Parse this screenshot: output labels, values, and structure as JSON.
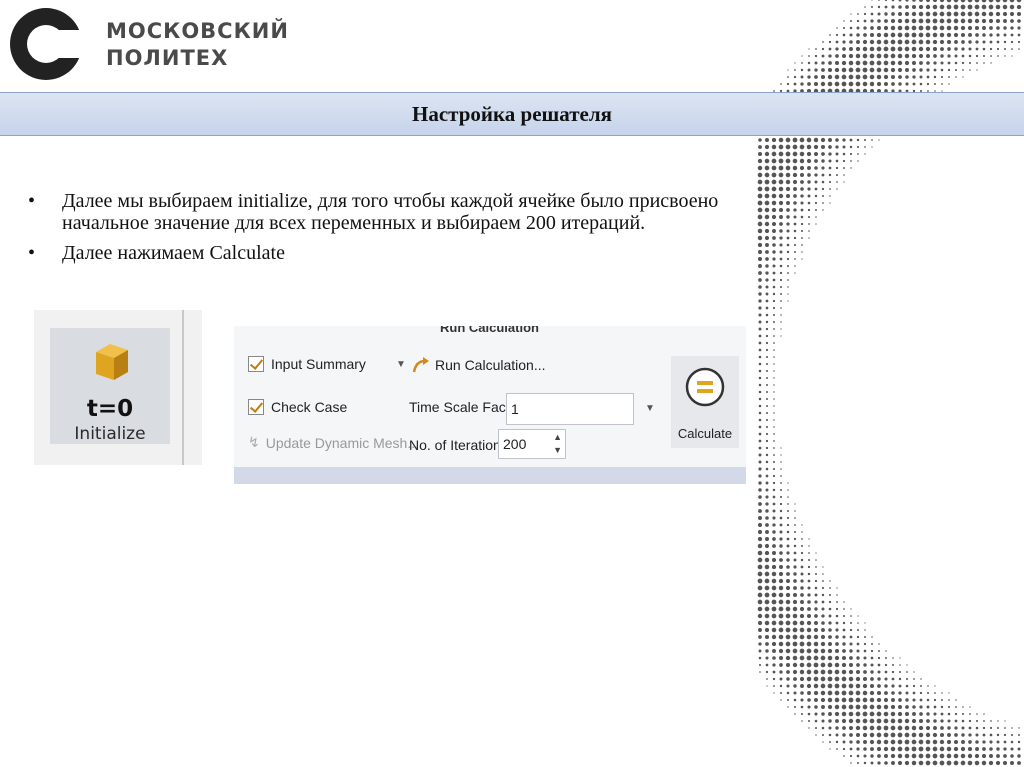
{
  "header": {
    "brand_line1": "МОСКОВСКИЙ",
    "brand_line2": "ПОЛИТЕХ"
  },
  "slide": {
    "title": "Настройка решателя",
    "bullets": [
      "Далее мы выбираем initialize, для того чтобы каждой ячейке было присвоено начальное значение для всех переменных и выбираем 200 итераций.",
      "Далее нажимаем Calculate"
    ],
    "bullet_symbol": "•"
  },
  "initialize_panel": {
    "t0_label": "t=0",
    "button_label": "Initialize",
    "icon": "cube-icon"
  },
  "run_panel": {
    "header": "Run Calculation",
    "input_summary": "Input Summary",
    "check_case": "Check Case",
    "update_mesh": "Update Dynamic Mesh...",
    "run_calc_link": "Run Calculation...",
    "time_scale_label": "Time Scale Factor",
    "time_scale_value": "1",
    "iterations_label": "No. of Iterations",
    "iterations_value": "200",
    "calculate_label": "Calculate"
  },
  "colors": {
    "title_bar": "#c6d3ea",
    "accent_orange": "#c07a10",
    "cube": "#e0a520"
  }
}
